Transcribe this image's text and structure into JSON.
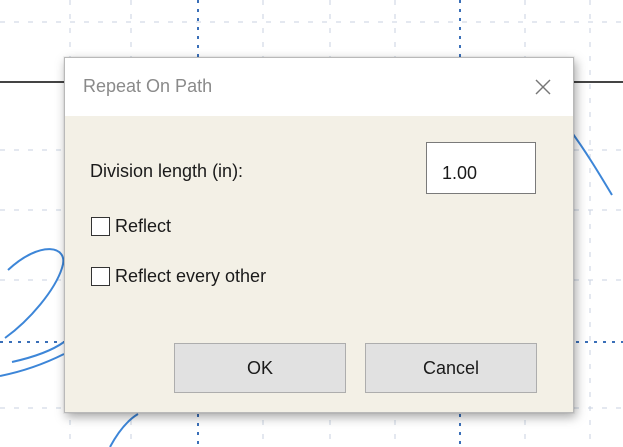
{
  "dialog": {
    "title": "Repeat On Path",
    "close_icon": "close-icon",
    "division_length": {
      "label": "Division length (in):",
      "value": "1.00"
    },
    "options": [
      {
        "label": "Reflect",
        "checked": false
      },
      {
        "label": "Reflect every other",
        "checked": false
      }
    ],
    "buttons": {
      "ok": "OK",
      "cancel": "Cancel"
    }
  },
  "colors": {
    "dialog_body": "#f3f0e6",
    "titlebar": "#ffffff",
    "grid": "#c8d2e0",
    "guide": "#3a6fb8",
    "path_stroke": "#3d86d8",
    "button_face": "#e1e1e1"
  }
}
